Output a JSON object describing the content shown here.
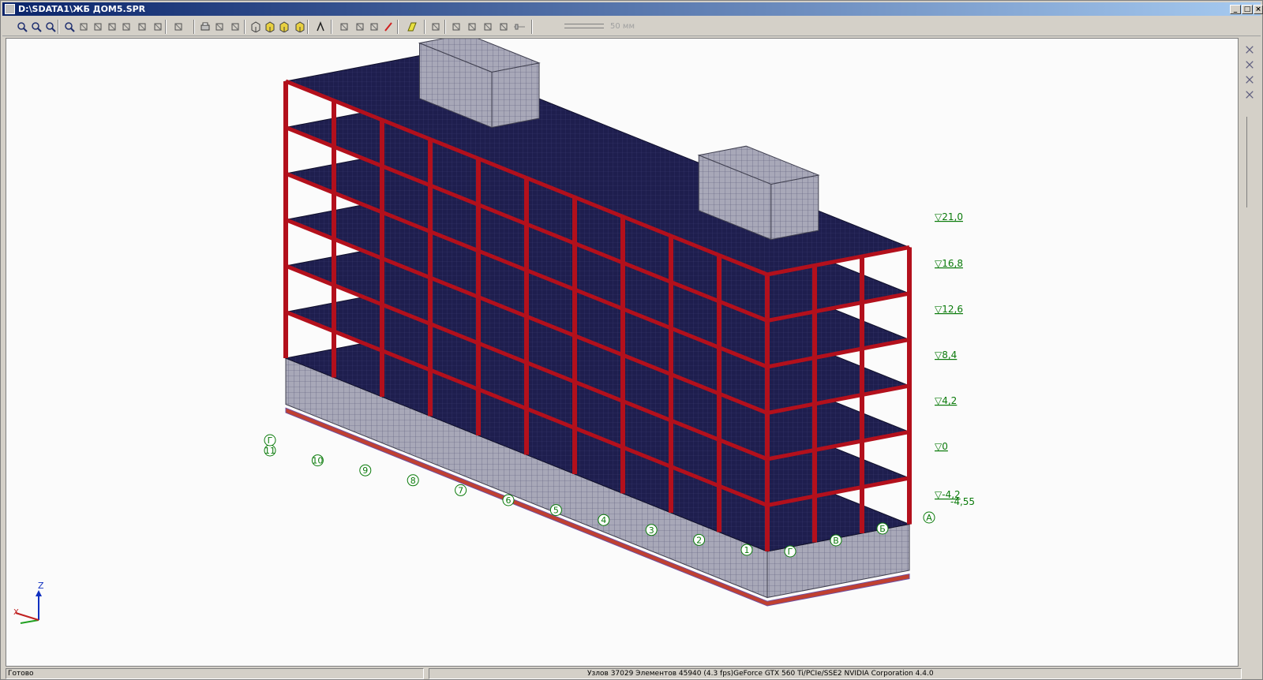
{
  "window": {
    "title": "D:\\SDATA1\\ЖБ ДОМ5.SPR",
    "minimize": "_",
    "maximize": "□",
    "close": "×"
  },
  "toolbar": {
    "scale_label": "50 мм",
    "icons": [
      "zoom-in-icon",
      "zoom-out-icon",
      "zoom-window-icon",
      "zoom-all-icon",
      "pan-icon",
      "rotate-icon",
      "orbit-icon",
      "select-node-icon",
      "select-element-icon",
      "filter-icon",
      "view-dropdown-icon",
      "print-icon",
      "preview-icon",
      "export-icon",
      "cube-wire-icon",
      "cube-solid-icon",
      "cube-color-icon",
      "cube-shade-icon",
      "lambda-icon",
      "point-icon",
      "nodes-icon",
      "grid-icon",
      "pen-icon",
      "fill-icon",
      "eraser-icon",
      "brush-icon",
      "pencil-icon",
      "tag-icon",
      "rectangle-icon",
      "slider-icon"
    ]
  },
  "viewport": {
    "levels": [
      "▽21,0",
      "▽16,8",
      "▽12,6",
      "▽8,4",
      "▽4,2",
      "▽0",
      "▽-4,2"
    ],
    "level_extra": "-4,55",
    "grid_axes_numeric": [
      "11",
      "10",
      "9",
      "8",
      "7",
      "6",
      "5",
      "4",
      "3",
      "2",
      "1"
    ],
    "grid_axes_letter": [
      "Г",
      "В",
      "Б",
      "А"
    ],
    "top_left_letter": "Г",
    "triad": {
      "z": "Z",
      "x": "X"
    }
  },
  "right_tools": [
    "scissors-icon",
    "cut-icon",
    "merge-icon",
    "split-icon"
  ],
  "status": {
    "left": "Готово",
    "right": "Узлов 37029  Элементов 45940  (4.3 fps)GeForce GTX 560 Ti/PCIe/SSE2 NVIDIA Corporation 4.4.0"
  },
  "colors": {
    "frame": "#b3101c",
    "slab": "#1e1e4e",
    "wall": "#a8a8b8",
    "level_text": "#0a7a0a"
  }
}
